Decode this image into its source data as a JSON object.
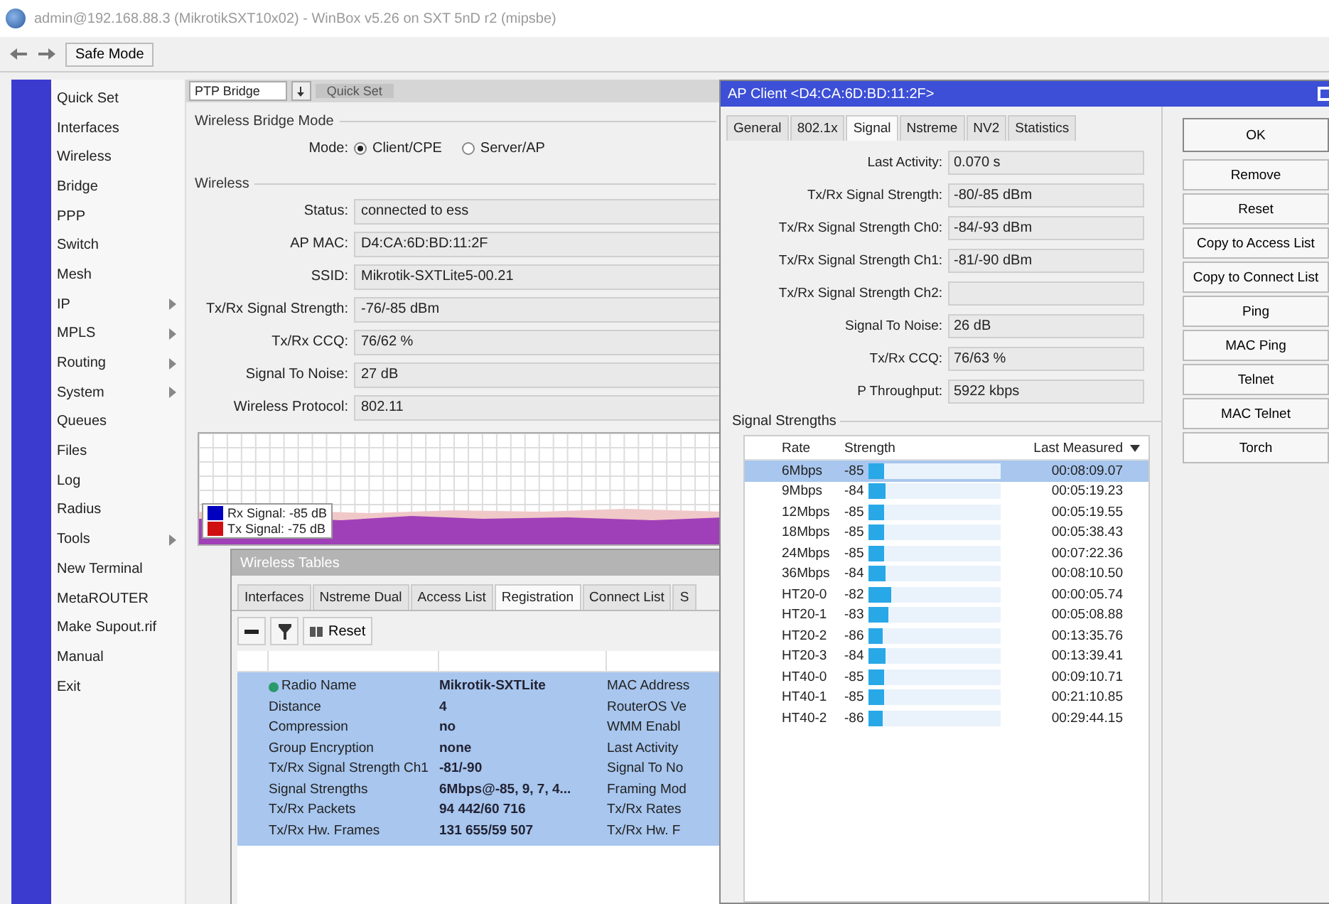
{
  "window": {
    "title": "admin@192.168.88.3 (MikrotikSXT10x02) - WinBox v5.26 on SXT 5nD r2 (mipsbe)"
  },
  "toolbar": {
    "safe_mode": "Safe Mode"
  },
  "sidebar": {
    "items": [
      {
        "label": "Quick Set",
        "submenu": false
      },
      {
        "label": "Interfaces",
        "submenu": false
      },
      {
        "label": "Wireless",
        "submenu": false
      },
      {
        "label": "Bridge",
        "submenu": false
      },
      {
        "label": "PPP",
        "submenu": false
      },
      {
        "label": "Switch",
        "submenu": false
      },
      {
        "label": "Mesh",
        "submenu": false
      },
      {
        "label": "IP",
        "submenu": true
      },
      {
        "label": "MPLS",
        "submenu": true
      },
      {
        "label": "Routing",
        "submenu": true
      },
      {
        "label": "System",
        "submenu": true
      },
      {
        "label": "Queues",
        "submenu": false
      },
      {
        "label": "Files",
        "submenu": false
      },
      {
        "label": "Log",
        "submenu": false
      },
      {
        "label": "Radius",
        "submenu": false
      },
      {
        "label": "Tools",
        "submenu": true
      },
      {
        "label": "New Terminal",
        "submenu": false
      },
      {
        "label": "MetaROUTER",
        "submenu": false
      },
      {
        "label": "Make Supout.rif",
        "submenu": false
      },
      {
        "label": "Manual",
        "submenu": false
      },
      {
        "label": "Exit",
        "submenu": false
      }
    ]
  },
  "quick_set": {
    "mode_select": "PTP Bridge",
    "title": "Quick Set",
    "bridge_mode": {
      "title": "Wireless Bridge Mode",
      "label": "Mode:",
      "options": [
        {
          "label": "Client/CPE",
          "selected": true
        },
        {
          "label": "Server/AP",
          "selected": false
        }
      ]
    },
    "wireless": {
      "title": "Wireless",
      "fields": [
        {
          "label": "Status:",
          "value": "connected to ess"
        },
        {
          "label": "AP MAC:",
          "value": "D4:CA:6D:BD:11:2F"
        },
        {
          "label": "SSID:",
          "value": "Mikrotik-SXTLite5-00.21"
        },
        {
          "label": "Tx/Rx Signal Strength:",
          "value": "-76/-85 dBm"
        },
        {
          "label": "Tx/Rx CCQ:",
          "value": "76/62 %"
        },
        {
          "label": "Signal To Noise:",
          "value": "27 dB"
        },
        {
          "label": "Wireless Protocol:",
          "value": "802.11"
        }
      ]
    },
    "graph": {
      "legend": [
        {
          "label": "Rx Signal: -85 dB",
          "color": "#0000c0"
        },
        {
          "label": "Tx Signal: -75 dB",
          "color": "#d01010"
        }
      ]
    }
  },
  "wireless_tables": {
    "title": "Wireless Tables",
    "tabs": [
      {
        "label": "Interfaces",
        "selected": false
      },
      {
        "label": "Nstreme Dual",
        "selected": false
      },
      {
        "label": "Access List",
        "selected": false
      },
      {
        "label": "Registration",
        "selected": true
      },
      {
        "label": "Connect List",
        "selected": false
      },
      {
        "label": "S",
        "selected": false
      }
    ],
    "reset": "Reset",
    "registration": {
      "selected": true,
      "fields": [
        {
          "name": "Radio Name",
          "value": "Mikrotik-SXTLite",
          "column_3": "MAC Address"
        },
        {
          "name": "Distance",
          "value": "4",
          "column_3": "RouterOS Ve"
        },
        {
          "name": "Compression",
          "value": "no",
          "column_3": "WMM Enabl"
        },
        {
          "name": "Group Encryption",
          "value": "none",
          "column_3": "Last Activity"
        },
        {
          "name": "Tx/Rx Signal Strength Ch1",
          "value": "-81/-90",
          "column_3": "Signal To No"
        },
        {
          "name": "Signal Strengths",
          "value": "6Mbps@-85, 9, 7, 4...",
          "column_3": "Framing Mod"
        },
        {
          "name": "Tx/Rx Packets",
          "value": "94 442/60 716",
          "column_3": "Tx/Rx Rates"
        },
        {
          "name": "Tx/Rx Hw. Frames",
          "value": "131 655/59 507",
          "column_3": "Tx/Rx Hw. F"
        }
      ]
    }
  },
  "ap_client": {
    "title": "AP Client <D4:CA:6D:BD:11:2F>",
    "tabs": [
      {
        "label": "General",
        "selected": false
      },
      {
        "label": "802.1x",
        "selected": false
      },
      {
        "label": "Signal",
        "selected": true
      },
      {
        "label": "Nstreme",
        "selected": false
      },
      {
        "label": "NV2",
        "selected": false
      },
      {
        "label": "Statistics",
        "selected": false
      }
    ],
    "fields": [
      {
        "label": "Last Activity:",
        "value": "0.070 s"
      },
      {
        "label": "Tx/Rx Signal Strength:",
        "value": "-80/-85 dBm"
      },
      {
        "label": "Tx/Rx Signal Strength Ch0:",
        "value": "-84/-93 dBm"
      },
      {
        "label": "Tx/Rx Signal Strength Ch1:",
        "value": "-81/-90 dBm"
      },
      {
        "label": "Tx/Rx Signal Strength Ch2:"
      },
      {
        "label": "Signal To Noise:",
        "value": "26 dB"
      },
      {
        "label": "Tx/Rx CCQ:",
        "value": "76/63 %"
      },
      {
        "label": "P Throughput:",
        "value": "5922 kbps"
      }
    ],
    "signal_strengths": {
      "title": "Signal Strengths",
      "columns": [
        "Rate",
        "Strength",
        "Last Measured"
      ],
      "rows": [
        {
          "rate": "6Mbps",
          "strength": "-85",
          "level": 0.12,
          "last_measured": "00:08:09.07",
          "selected": true
        },
        {
          "rate": "9Mbps",
          "strength": "-84",
          "level": 0.13,
          "last_measured": "00:05:19.23",
          "selected": false
        },
        {
          "rate": "12Mbps",
          "strength": "-85",
          "level": 0.12,
          "last_measured": "00:05:19.55",
          "selected": false
        },
        {
          "rate": "18Mbps",
          "strength": "-85",
          "level": 0.12,
          "last_measured": "00:05:38.43",
          "selected": false
        },
        {
          "rate": "24Mbps",
          "strength": "-85",
          "level": 0.12,
          "last_measured": "00:07:22.36",
          "selected": false
        },
        {
          "rate": "36Mbps",
          "strength": "-84",
          "level": 0.13,
          "last_measured": "00:08:10.50",
          "selected": false
        },
        {
          "rate": "HT20-0",
          "strength": "-82",
          "level": 0.17,
          "last_measured": "00:00:05.74",
          "selected": false
        },
        {
          "rate": "HT20-1",
          "strength": "-83",
          "level": 0.15,
          "last_measured": "00:05:08.88",
          "selected": false
        },
        {
          "rate": "HT20-2",
          "strength": "-86",
          "level": 0.11,
          "last_measured": "00:13:35.76",
          "selected": false
        },
        {
          "rate": "HT20-3",
          "strength": "-84",
          "level": 0.13,
          "last_measured": "00:13:39.41",
          "selected": false
        },
        {
          "rate": "HT40-0",
          "strength": "-85",
          "level": 0.12,
          "last_measured": "00:09:10.71",
          "selected": false
        },
        {
          "rate": "HT40-1",
          "strength": "-85",
          "level": 0.12,
          "last_measured": "00:21:10.85",
          "selected": false
        },
        {
          "rate": "HT40-2",
          "strength": "-86",
          "level": 0.11,
          "last_measured": "00:29:44.15",
          "selected": false
        }
      ]
    },
    "buttons": [
      "OK",
      "Remove",
      "Reset",
      "Copy to Access List",
      "Copy to Connect List",
      "Ping",
      "MAC Ping",
      "Telnet",
      "MAC Telnet",
      "Torch"
    ]
  }
}
